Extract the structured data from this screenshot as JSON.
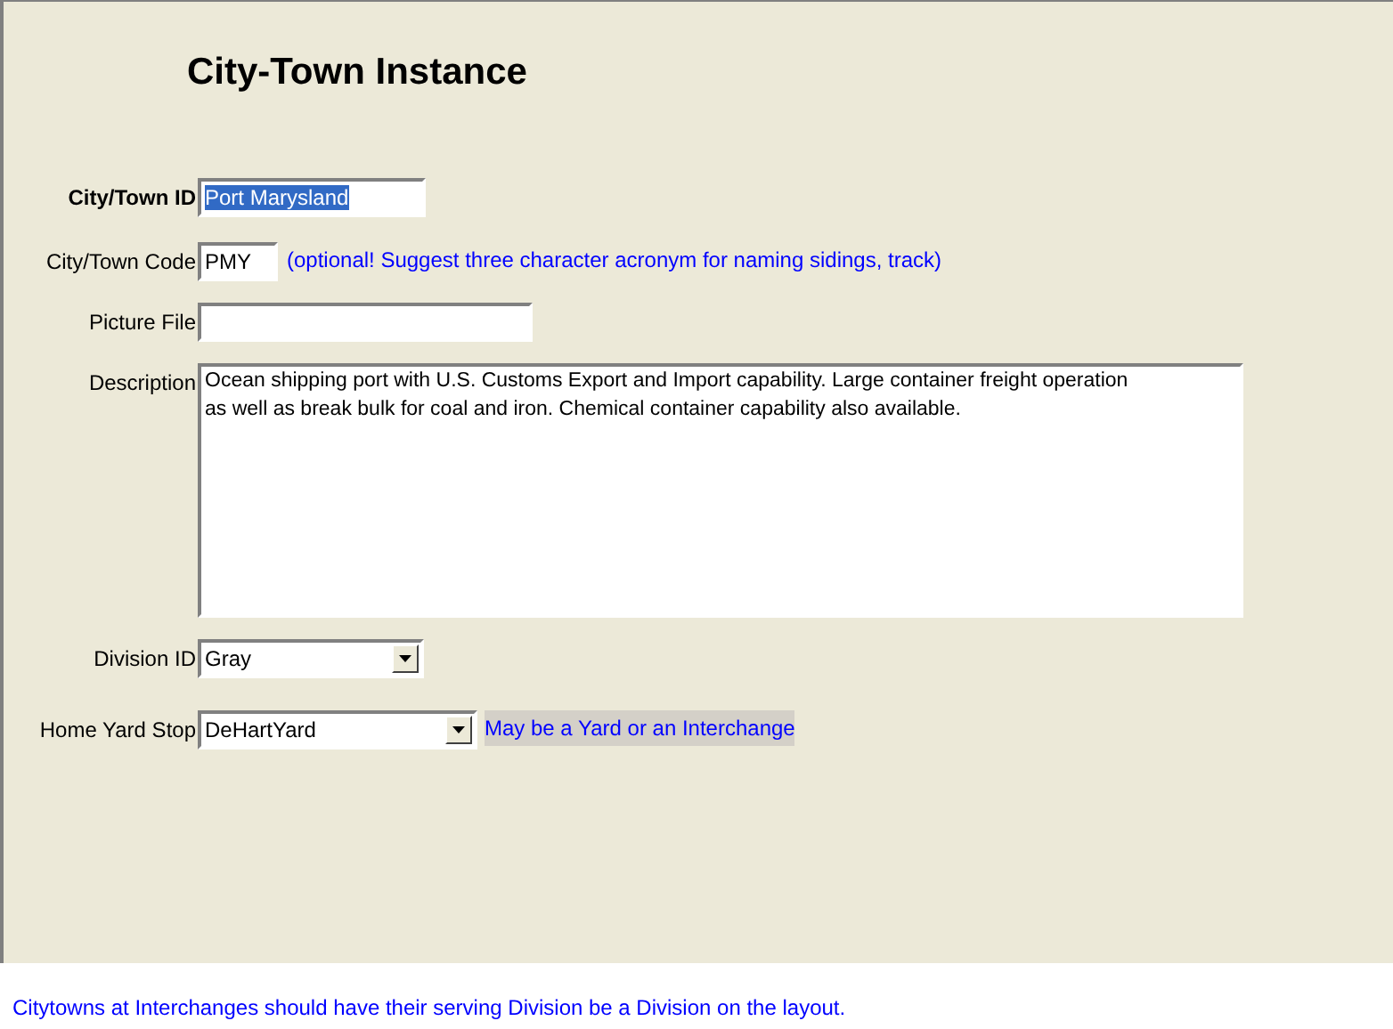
{
  "title": "City-Town Instance",
  "fields": [
    {
      "kind": "text",
      "label": "City/Town ID",
      "label_bold": true,
      "value": "Port Marysland",
      "text_selected": true
    },
    {
      "kind": "text",
      "label": "City/Town Code",
      "label_bold": false,
      "value": "PMY",
      "text_selected": false,
      "note": {
        "text": "(optional! Suggest three character acronym for naming sidings, track)",
        "shaded": false
      }
    },
    {
      "kind": "text",
      "label": "Picture File",
      "label_bold": false
    },
    {
      "kind": "textarea",
      "label": "Description",
      "label_bold": false,
      "value": "Ocean shipping port with U.S. Customs Export and Import capability. Large container freight operation as well as break bulk for coal and iron. Chemical container capability also available.",
      "text_selected": false
    },
    {
      "kind": "select",
      "label": "Division ID",
      "label_bold": false,
      "value": "Gray",
      "text_selected": false
    },
    {
      "kind": "select",
      "label": "Home Yard Stop",
      "label_bold": false,
      "value": "DeHartYard",
      "text_selected": false,
      "note": {
        "text": "May be a Yard or an Interchange",
        "shaded": true
      }
    }
  ],
  "footer_note": "Citytowns at Interchanges should have their serving Division be a Division on the layout."
}
